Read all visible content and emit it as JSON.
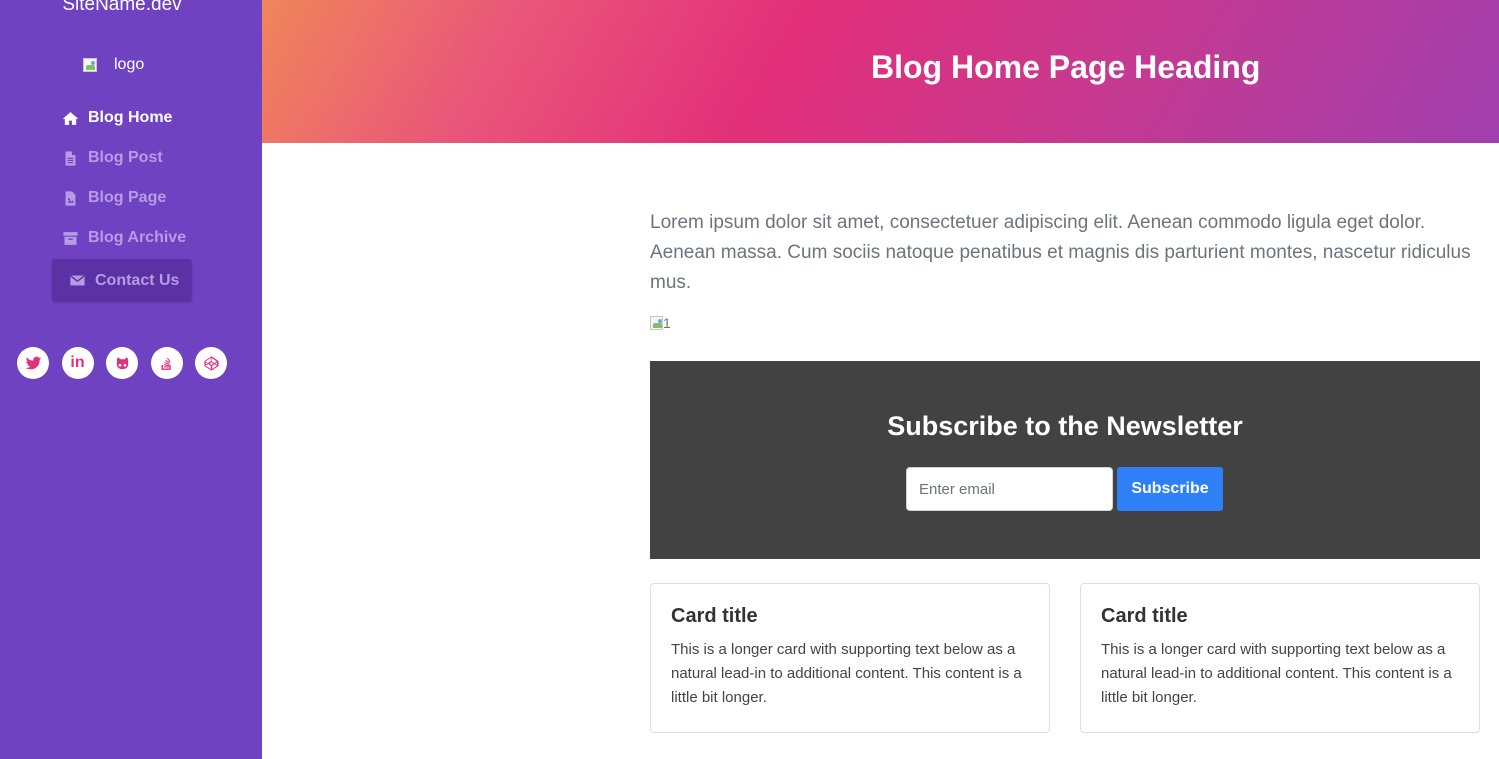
{
  "sidebar": {
    "site_name": "SiteName.dev",
    "logo_alt": "logo",
    "nav": [
      {
        "label": "Blog Home",
        "icon": "home-icon",
        "active": true
      },
      {
        "label": "Blog Post",
        "icon": "file-icon",
        "active": false
      },
      {
        "label": "Blog Page",
        "icon": "file-image-icon",
        "active": false
      },
      {
        "label": "Blog Archive",
        "icon": "archive-icon",
        "active": false
      },
      {
        "label": "Contact Us",
        "icon": "envelope-icon",
        "active": false
      }
    ],
    "socials": [
      "twitter-icon",
      "linkedin-icon",
      "github-icon",
      "stackoverflow-icon",
      "codepen-icon"
    ]
  },
  "hero": {
    "title": "Blog Home Page Heading"
  },
  "main": {
    "intro": "Lorem ipsum dolor sit amet, consectetuer adipiscing elit. Aenean commodo ligula eget dolor. Aenean massa. Cum sociis natoque penatibus et magnis dis parturient montes, nascetur ridiculus mus.",
    "image_alt": "1"
  },
  "newsletter": {
    "title": "Subscribe to the Newsletter",
    "email_placeholder": "Enter email",
    "button_label": "Subscribe"
  },
  "cards": [
    {
      "title": "Card title",
      "text": "This is a longer card with supporting text below as a natural lead-in to additional content. This content is a little bit longer."
    },
    {
      "title": "Card title",
      "text": "This is a longer card with supporting text below as a natural lead-in to additional content. This content is a little bit longer."
    }
  ],
  "colors": {
    "sidebar_bg": "#6f42c1",
    "accent_pink": "#e0317c",
    "newsletter_bg": "#424242",
    "button_blue": "#2f80f6"
  }
}
